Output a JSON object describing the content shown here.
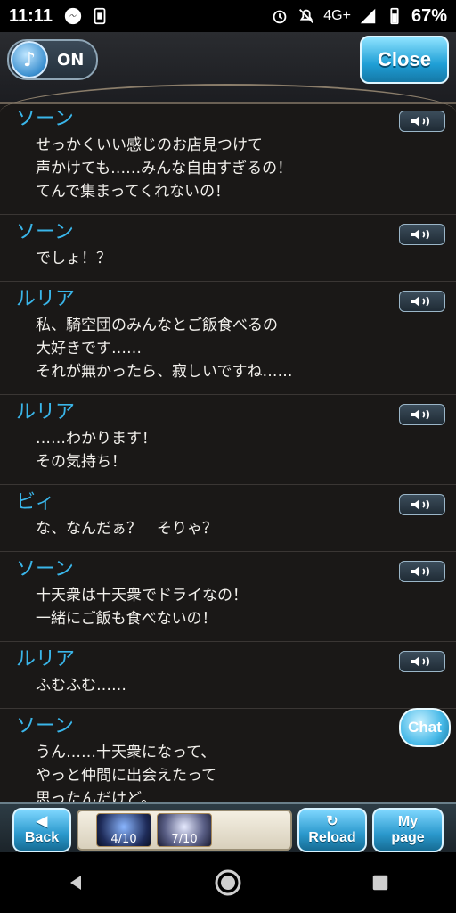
{
  "status_bar": {
    "time": "11:11",
    "network": "4G+",
    "battery": "67%"
  },
  "header": {
    "music_label": "ON",
    "close_label": "Close"
  },
  "log": [
    {
      "speaker": "ソーン",
      "lines": [
        "せっかくいい感じのお店見つけて",
        "声かけても……みんな自由すぎるの！",
        "てんで集まってくれないの！"
      ]
    },
    {
      "speaker": "ソーン",
      "lines": [
        "でしょ！？"
      ]
    },
    {
      "speaker": "ルリア",
      "lines": [
        "私、騎空団のみんなとご飯食べるの",
        "大好きです……",
        "それが無かったら、寂しいですね……"
      ]
    },
    {
      "speaker": "ルリア",
      "lines": [
        "……わかります！",
        "その気持ち！"
      ]
    },
    {
      "speaker": "ビィ",
      "lines": [
        "な、なんだぁ？　そりゃ？"
      ]
    },
    {
      "speaker": "ソーン",
      "lines": [
        "十天衆は十天衆でドライなの！",
        "一緒にご飯も食べないの！"
      ]
    },
    {
      "speaker": "ルリア",
      "lines": [
        "ふむふむ……"
      ]
    },
    {
      "speaker": "ソーン",
      "lines": [
        "うん……十天衆になって、",
        "やっと仲間に出会えたって",
        "思ったんだけど。"
      ]
    }
  ],
  "chat_label": "Chat",
  "bottom_bar": {
    "back_label": "Back",
    "reload_label": "Reload",
    "mypage_line1": "My",
    "mypage_line2": "page",
    "ap": "4/10",
    "bp": "7/10"
  }
}
